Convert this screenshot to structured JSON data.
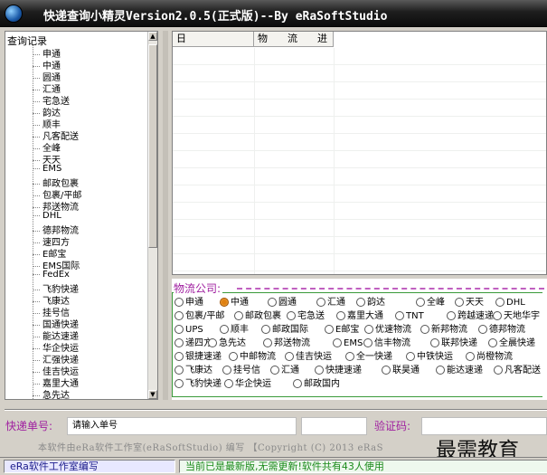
{
  "window": {
    "title": "快递查询小精灵Version2.0.5(正式版)--By eRaSoftStudio"
  },
  "tree": {
    "root_label": "查询记录",
    "items": [
      "申通",
      "中通",
      "圆通",
      "汇通",
      "宅急送",
      "韵达",
      "顺丰",
      "凡客配送",
      "全峰",
      "天天",
      "EMS",
      "邮政包裹",
      "包裹/平邮",
      "邦送物流",
      "DHL",
      "德邦物流",
      "速四方",
      "E邮宝",
      "EMS国际",
      "FedEx",
      "飞豹快递",
      "飞康达",
      "挂号信",
      "国通快递",
      "能达速递",
      "华企快运",
      "汇强快递",
      "佳吉快运",
      "嘉里大通",
      "急先达"
    ]
  },
  "list": {
    "columns": [
      "日",
      "物　　流　　进"
    ]
  },
  "logistics": {
    "title": "物流公司:",
    "selected": "中通",
    "options": [
      [
        "申通",
        "中通",
        "圆通",
        "汇通",
        "韵达",
        "全峰",
        "天天",
        "DHL"
      ],
      [
        "包裹/平邮",
        "邮政包裹",
        "宅急送",
        "嘉里大通",
        "TNT",
        "跨越速递",
        "天地华宇"
      ],
      [
        "UPS",
        "顺丰",
        "邮政国际",
        "E邮宝",
        "优速物流",
        "新邦物流",
        "德邦物流"
      ],
      [
        "递四方",
        "急先达",
        "邦送物流",
        "EMS",
        "信丰物流",
        "联邦快递",
        "全晨快递"
      ],
      [
        "银捷速递",
        "中邮物流",
        "佳吉快运",
        "全一快递",
        "中铁快运",
        "尚橙物流"
      ],
      [
        "飞康达",
        "挂号信",
        "汇通",
        "快捷速递",
        "联昊通",
        "能达速递",
        "凡客配送"
      ],
      [
        "飞豹快递",
        "华企快运",
        "邮政国内"
      ]
    ]
  },
  "input": {
    "tracking_label": "快递单号:",
    "tracking_value": "请输入单号",
    "captcha_label": "验证码:"
  },
  "footer": {
    "copyright": "本软件由eRa软件工作室(eRaSoftStudio) 编写 【Copyright (C) 2013 eRaS",
    "watermark": "最需教育"
  },
  "status": {
    "left": "eRa软件工作室编写",
    "right": "当前已是最新版,无需更新!软件共有43人使用"
  }
}
